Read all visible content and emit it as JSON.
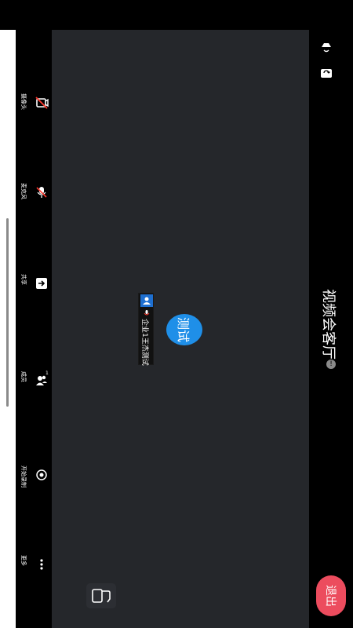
{
  "window": {
    "title": "视频会客厅"
  },
  "toolbar": {
    "items": [
      {
        "label": "摄像头",
        "icon": "camera-off-icon"
      },
      {
        "label": "麦克风",
        "icon": "microphone-muted-icon"
      },
      {
        "label": "共享",
        "icon": "share-screen-icon"
      },
      {
        "label": "成员",
        "icon": "members-icon",
        "count": "1"
      },
      {
        "label": "开始录制",
        "icon": "record-icon"
      },
      {
        "label": "更多",
        "icon": "more-icon"
      }
    ]
  },
  "participant": {
    "avatar_text": "测试",
    "name": "企业1王杰测试"
  },
  "rail": {
    "exit_label": "退出",
    "info_symbol": "!"
  },
  "colors": {
    "stage_bg": "#25272b",
    "avatar_bg": "#1f8fe8",
    "exit_bg": "#ec4c5e",
    "badge_bg": "#1e6fd0"
  }
}
